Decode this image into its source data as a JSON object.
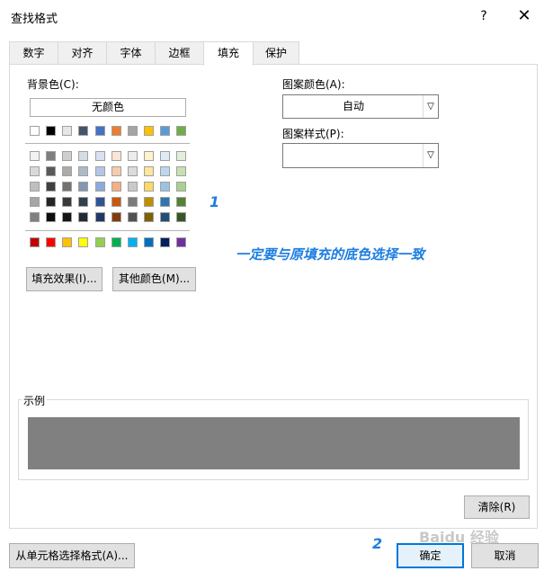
{
  "dialog": {
    "title": "查找格式",
    "help": "?",
    "close": "✕"
  },
  "tabs": [
    {
      "label": "数字",
      "active": false
    },
    {
      "label": "对齐",
      "active": false
    },
    {
      "label": "字体",
      "active": false
    },
    {
      "label": "边框",
      "active": false
    },
    {
      "label": "填充",
      "active": true
    },
    {
      "label": "保护",
      "active": false
    }
  ],
  "fill": {
    "bg_color_label": "背景色(C):",
    "no_color_button": "无颜色",
    "fill_effects_button": "填充效果(I)...",
    "more_colors_button": "其他颜色(M)...",
    "pattern_color_label": "图案颜色(A):",
    "pattern_color_value": "自动",
    "pattern_style_label": "图案样式(P):",
    "pattern_style_value": "",
    "sample_label": "示例",
    "sample_color": "#808080",
    "clear_button": "清除(R)"
  },
  "palette": {
    "top_row": [
      "#ffffff",
      "#000000",
      "#e7e6e6",
      "#44546a",
      "#4472c4",
      "#ed7d31",
      "#a5a5a5",
      "#ffc000",
      "#5b9bd5",
      "#70ad47"
    ],
    "theme_rows": [
      [
        "#f2f2f2",
        "#7f7f7f",
        "#d0cece",
        "#d6dce4",
        "#d9e1f2",
        "#fce4d6",
        "#ededed",
        "#fff2cc",
        "#ddebf7",
        "#e2efda"
      ],
      [
        "#d9d9d9",
        "#595959",
        "#aeaaaa",
        "#acb9ca",
        "#b4c6e7",
        "#f8cbad",
        "#dbdbdb",
        "#ffe699",
        "#bdd7ee",
        "#c6e0b4"
      ],
      [
        "#bfbfbf",
        "#404040",
        "#757171",
        "#8497b0",
        "#8ea9db",
        "#f4b084",
        "#c9c9c9",
        "#ffd966",
        "#9bc2e6",
        "#a9d08e"
      ],
      [
        "#a6a6a6",
        "#262626",
        "#3a3838",
        "#333f4f",
        "#2f5597",
        "#c65911",
        "#7b7b7b",
        "#bf8f00",
        "#2e75b6",
        "#548235"
      ],
      [
        "#808080",
        "#0d0d0d",
        "#161616",
        "#222b35",
        "#203864",
        "#833c0c",
        "#525252",
        "#806000",
        "#1f4e78",
        "#375623"
      ]
    ],
    "standard_row": [
      "#c00000",
      "#ff0000",
      "#ffc000",
      "#ffff00",
      "#92d050",
      "#00b050",
      "#00b0f0",
      "#0070c0",
      "#002060",
      "#7030a0"
    ],
    "selected": "#7b7b7b"
  },
  "footer": {
    "from_cell_button": "从单元格选择格式(A)...",
    "ok_button": "确定",
    "cancel_button": "取消"
  },
  "annotations": {
    "marker1": "1",
    "marker2": "2",
    "note": "一定要与原填充的底色选择一致"
  },
  "watermark": "Baidu 经验"
}
